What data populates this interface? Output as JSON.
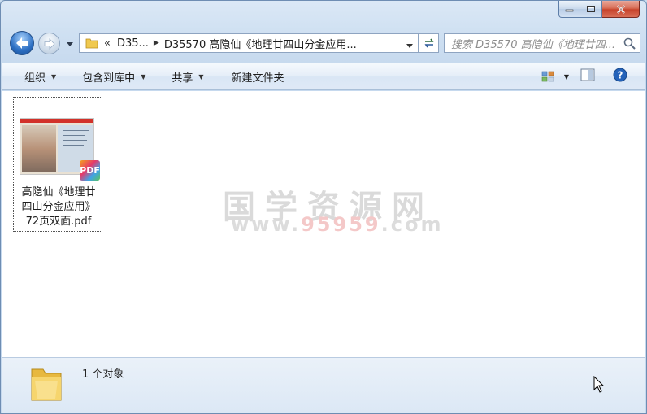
{
  "window": {
    "caption_buttons": {
      "minimize": "minimize",
      "maximize": "maximize",
      "close": "close"
    }
  },
  "navbar": {
    "breadcrumbs": [
      "«",
      "D35...",
      "D35570 高隐仙《地理廿四山分金应用..."
    ],
    "search_placeholder": "搜索 D35570 高隐仙《地理廿四..."
  },
  "toolbar": {
    "organize": "组织",
    "include_in_library": "包含到库中",
    "share": "共享",
    "new_folder": "新建文件夹"
  },
  "files": [
    {
      "name_line1": "高隐仙《地理廿",
      "name_line2": "四山分金应用》",
      "name_line3": "72页双面.pdf",
      "badge": "PDF",
      "thumb_label": "PDF",
      "thumb_title": "地理廿四山分金应用"
    }
  ],
  "watermark": {
    "main": "国学资源网",
    "url_prefix": "www.",
    "url_accent": "95959",
    "url_suffix": ".com"
  },
  "details": {
    "count_text": "1 个对象"
  },
  "colors": {
    "accent": "#2c6fc3",
    "close_red": "#c7432b",
    "window_frame": "#c9dcef"
  }
}
